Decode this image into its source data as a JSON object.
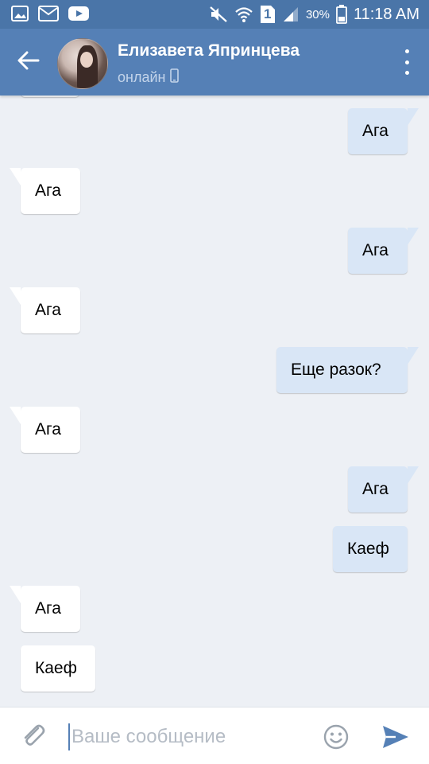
{
  "status_bar": {
    "time": "11:18 AM",
    "battery_percent": "30%",
    "sim_indicator": "1",
    "icons": [
      "gallery-icon",
      "mail-icon",
      "youtube-icon",
      "mute-icon",
      "wifi-icon",
      "sim-icon",
      "signal-icon",
      "battery-icon"
    ]
  },
  "header": {
    "contact_name": "Елизавета Япринцева",
    "status_text": "онлайн",
    "status_device_icon": "phone-icon",
    "accent_color": "#5580b6"
  },
  "messages": [
    {
      "side": "out",
      "text": "Ага"
    },
    {
      "side": "in",
      "text": "Ага"
    },
    {
      "side": "out",
      "text": "Ага"
    },
    {
      "side": "in",
      "text": "Ага"
    },
    {
      "side": "out",
      "text": "Еще разок?"
    },
    {
      "side": "in",
      "text": "Ага"
    },
    {
      "side": "out",
      "text": "Ага"
    },
    {
      "side": "out",
      "text": "Каеф"
    },
    {
      "side": "in",
      "text": "Ага"
    },
    {
      "side": "in",
      "text": "Каеф"
    }
  ],
  "composer": {
    "placeholder": "Ваше сообщение",
    "value": ""
  },
  "colors": {
    "status_bar": "#4a75a8",
    "incoming_bubble": "#ffffff",
    "outgoing_bubble": "#d9e6f6",
    "background": "#edf0f5"
  }
}
